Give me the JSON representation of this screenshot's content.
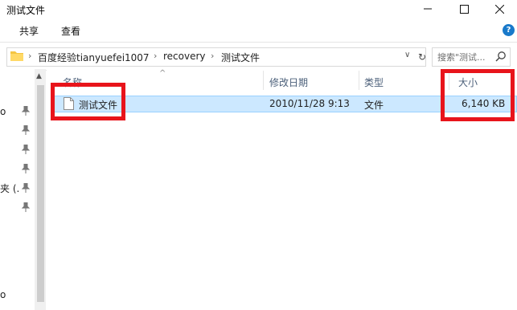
{
  "window": {
    "title": "测试文件",
    "controls": [
      "minimize",
      "maximize",
      "close"
    ]
  },
  "ribbon": {
    "tabs": [
      "共享",
      "查看"
    ],
    "help_label": "?"
  },
  "address": {
    "breadcrumbs": [
      "百度经验tianyuefei1007",
      "recovery",
      "测试文件"
    ],
    "search_placeholder": "搜索\"测试..."
  },
  "nav": {
    "visible_fragments": [
      "o",
      "夹 (.",
      "o"
    ]
  },
  "columns": {
    "name": "名称",
    "modified": "修改日期",
    "type": "类型",
    "size": "大小"
  },
  "files": [
    {
      "name": "测试文件",
      "modified": "2010/11/28 9:13",
      "type": "文件",
      "size": "6,140 KB",
      "selected": true
    }
  ],
  "colors": {
    "selection_bg": "#cce8ff",
    "highlight_box": "#e8141b",
    "accent": "#1979ca"
  }
}
